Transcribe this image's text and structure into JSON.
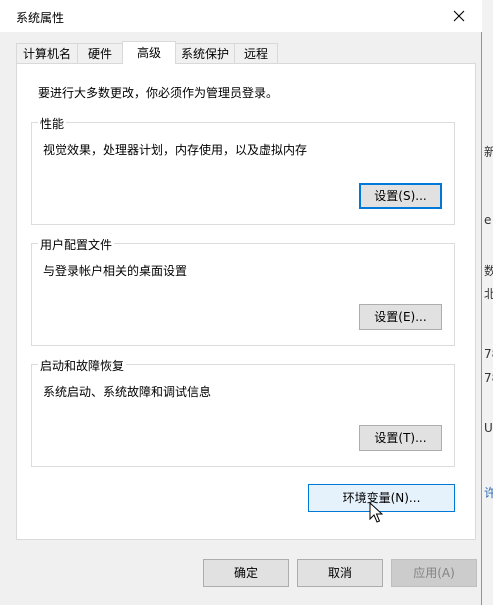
{
  "window": {
    "title": "系统属性"
  },
  "tabs": [
    {
      "label": "计算机名",
      "active": false
    },
    {
      "label": "硬件",
      "active": false
    },
    {
      "label": "高级",
      "active": true
    },
    {
      "label": "系统保护",
      "active": false
    },
    {
      "label": "远程",
      "active": false
    }
  ],
  "notice": "要进行大多数更改，你必须作为管理员登录。",
  "groups": {
    "performance": {
      "title": "性能",
      "desc": "视觉效果，处理器计划，内存使用，以及虚拟内存",
      "button": "设置(S)..."
    },
    "profile": {
      "title": "用户配置文件",
      "desc": "与登录帐户相关的桌面设置",
      "button": "设置(E)..."
    },
    "startup": {
      "title": "启动和故障恢复",
      "desc": "系统启动、系统故障和调试信息",
      "button": "设置(T)..."
    }
  },
  "env_button": "环境变量(N)...",
  "footer": {
    "ok": "确定",
    "cancel": "取消",
    "apply": "应用(A)"
  },
  "background_fragments": [
    "新",
    "e",
    "数",
    "北",
    "78",
    "78",
    "U",
    "许"
  ],
  "colors": {
    "focus_border": "#0078d7",
    "hover_bg": "#e5f1fb"
  }
}
